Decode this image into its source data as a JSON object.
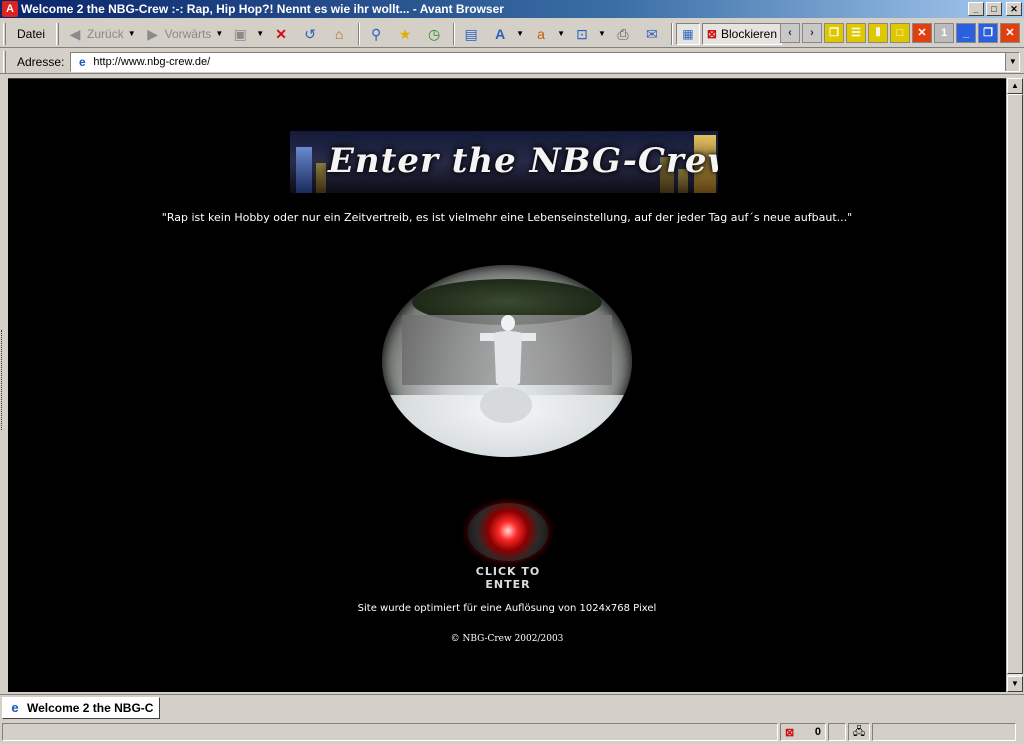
{
  "window": {
    "title": "Welcome 2 the NBG-Crew :-: Rap, Hip Hop?! Nennt es wie ihr wollt... - Avant Browser",
    "app_icon": "avant-logo-icon"
  },
  "window_controls": {
    "minimize": "_",
    "maximize": "□",
    "close": "✕"
  },
  "toolbar": {
    "menu_file": "Datei",
    "back": "Zurück",
    "forward": "Vorwärts",
    "block": "Blockieren"
  },
  "right_tools": {
    "one": "1"
  },
  "address": {
    "label": "Adresse:",
    "url": "http://www.nbg-crew.de/"
  },
  "page": {
    "banner_text": "Enter the NBG-Crew",
    "quote": "\"Rap ist kein Hobby oder nur ein Zeitvertreib, es ist vielmehr eine Lebenseinstellung, auf der jeder Tag auf´s neue aufbaut...\"",
    "enter_label": "CLICK TO ENTER",
    "optimized_note": "Site wurde optimiert für eine Auflösung von 1024x768 Pixel",
    "copyright": "© NBG-Crew 2002/2003"
  },
  "tabs": [
    {
      "label": "Welcome 2 the NBG-C"
    }
  ],
  "status": {
    "blocked_count": "0"
  },
  "colors": {
    "titlebar": "#0a246a",
    "page_bg": "#000000",
    "chrome": "#d4d0c8"
  }
}
